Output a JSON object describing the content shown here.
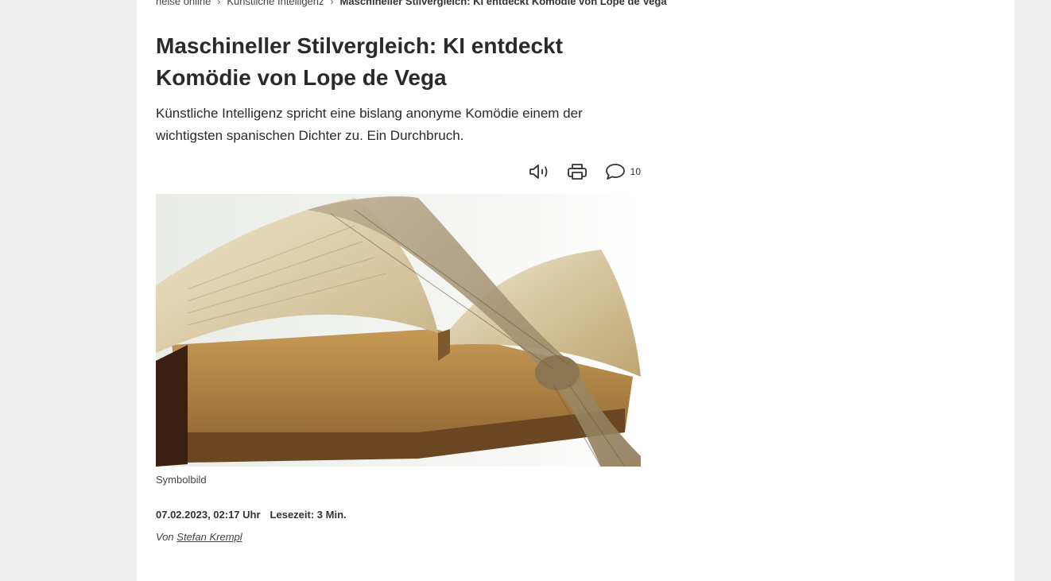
{
  "breadcrumb": {
    "items": [
      "heise online",
      "Künstliche Intelligenz"
    ],
    "current": "Maschineller Stilvergleich: KI entdeckt Komödie von Lope de Vega"
  },
  "article": {
    "title": "Maschineller Stilvergleich: KI entdeckt Komödie von Lope de Vega",
    "lead": "Künstliche Intelligenz spricht eine bislang anonyme Komödie einem der wichtigsten spanischen Dichter zu. Ein Durchbruch.",
    "image_caption": "Symbolbild",
    "date": "07.02.2023, 02:17 Uhr",
    "reading_time": "Lesezeit: 3 Min.",
    "byline_prefix": "Von",
    "author": "Stefan Krempl"
  },
  "actions": {
    "comment_count": "10",
    "icons": [
      "speaker-icon",
      "print-icon",
      "comment-icon"
    ]
  },
  "colors": {
    "background": "#efefef",
    "page": "#ffffff",
    "text": "#2a2a2a"
  }
}
